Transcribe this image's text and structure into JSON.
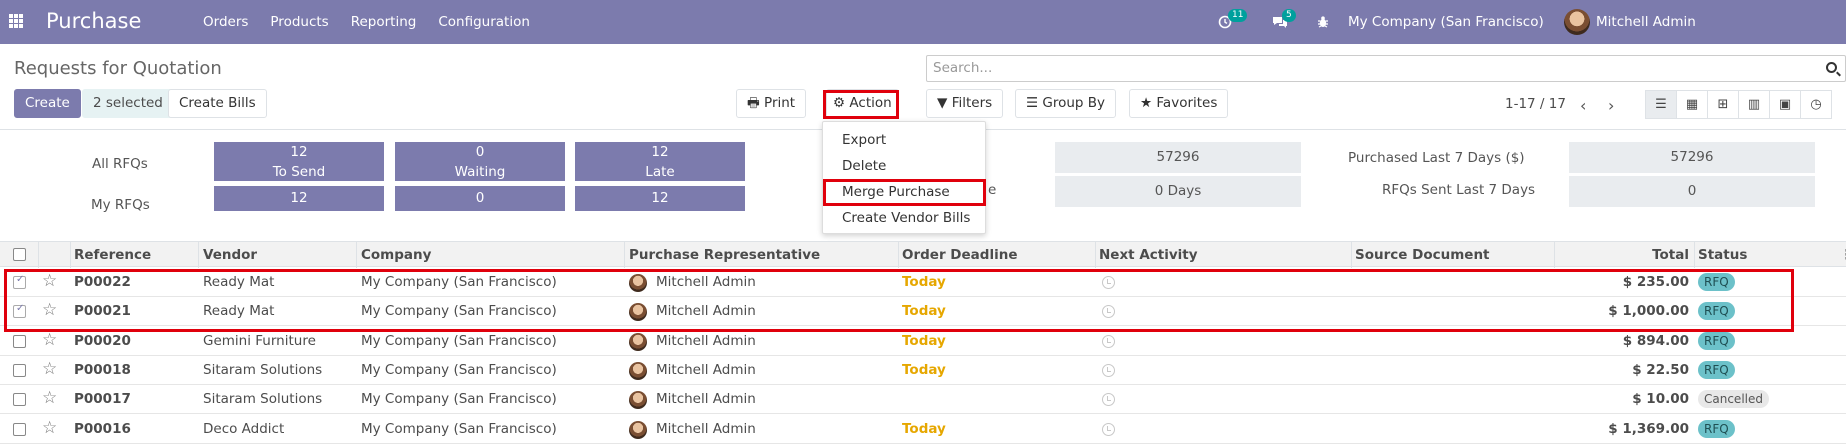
{
  "app": {
    "title": "Purchase",
    "nav": [
      "Orders",
      "Products",
      "Reporting",
      "Configuration"
    ],
    "activity_count": "11",
    "message_count": "5",
    "company": "My Company (San Francisco)",
    "user": "Mitchell Admin"
  },
  "control": {
    "page_title": "Requests for Quotation",
    "create_label": "Create",
    "selected_label": "2 selected",
    "create_bills_label": "Create Bills",
    "print_label": "Print",
    "action_label": "Action",
    "search_placeholder": "Search...",
    "filters_label": "Filters",
    "groupby_label": "Group By",
    "favorites_label": "Favorites",
    "pager": "1-17 / 17"
  },
  "action_menu": [
    "Export",
    "Delete",
    "Merge Purchase",
    "Create Vendor Bills"
  ],
  "dashboard": {
    "all_rfqs_label": "All RFQs",
    "my_rfqs_label": "My RFQs",
    "tiles": [
      {
        "value": "12",
        "label": "To Send",
        "mine": "12"
      },
      {
        "value": "0",
        "label": "Waiting",
        "mine": "0"
      },
      {
        "value": "12",
        "label": "Late",
        "mine": "12"
      }
    ],
    "avg_value_partial_label": "e",
    "stat1_value": "57296",
    "stat2_value": "0  Days",
    "purchased_label": "Purchased Last 7 Days ($)",
    "purchased_value": "57296",
    "sent_label": "RFQs Sent Last 7 Days",
    "sent_value": "0"
  },
  "table": {
    "headers": [
      "Reference",
      "Vendor",
      "Company",
      "Purchase Representative",
      "Order Deadline",
      "Next Activity",
      "Source Document",
      "Total",
      "Status"
    ],
    "rows": [
      {
        "ref": "P00022",
        "vendor": "Ready Mat",
        "company": "My Company (San Francisco)",
        "rep": "Mitchell Admin",
        "deadline": "Today",
        "total": "$ 235.00",
        "status": "RFQ",
        "checked": true
      },
      {
        "ref": "P00021",
        "vendor": "Ready Mat",
        "company": "My Company (San Francisco)",
        "rep": "Mitchell Admin",
        "deadline": "Today",
        "total": "$ 1,000.00",
        "status": "RFQ",
        "checked": true
      },
      {
        "ref": "P00020",
        "vendor": "Gemini Furniture",
        "company": "My Company (San Francisco)",
        "rep": "Mitchell Admin",
        "deadline": "Today",
        "total": "$ 894.00",
        "status": "RFQ",
        "checked": false
      },
      {
        "ref": "P00018",
        "vendor": "Sitaram Solutions",
        "company": "My Company (San Francisco)",
        "rep": "Mitchell Admin",
        "deadline": "Today",
        "total": "$ 22.50",
        "status": "RFQ",
        "checked": false
      },
      {
        "ref": "P00017",
        "vendor": "Sitaram Solutions",
        "company": "My Company (San Francisco)",
        "rep": "Mitchell Admin",
        "deadline": "",
        "total": "$ 10.00",
        "status": "Cancelled",
        "checked": false
      },
      {
        "ref": "P00016",
        "vendor": "Deco Addict",
        "company": "My Company (San Francisco)",
        "rep": "Mitchell Admin",
        "deadline": "Today",
        "total": "$ 1,369.00",
        "status": "RFQ",
        "checked": false
      }
    ]
  },
  "colors": {
    "brand": "#7c7bad",
    "highlight": "#e0000c",
    "today": "#e6a700",
    "rfq_badge": "#6cc1c9"
  }
}
